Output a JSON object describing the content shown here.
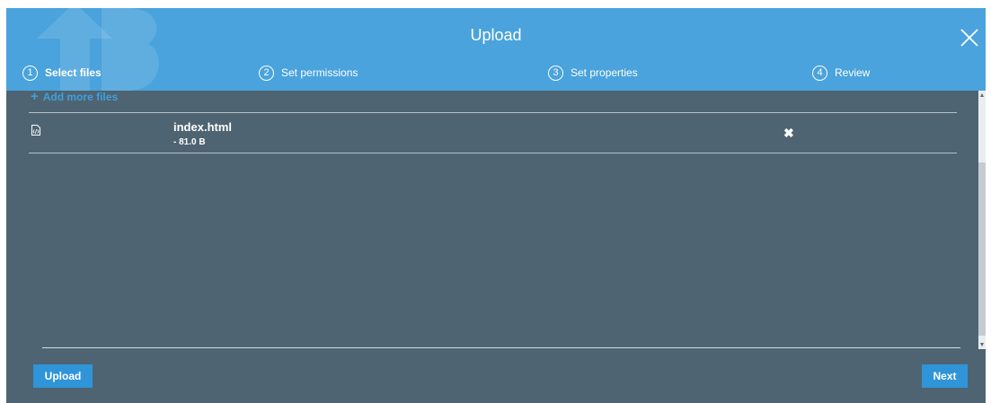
{
  "dialog": {
    "title": "Upload",
    "close_icon": "close-icon"
  },
  "steps": [
    {
      "number": "1",
      "label": "Select files",
      "active": true
    },
    {
      "number": "2",
      "label": "Set permissions",
      "active": false
    },
    {
      "number": "3",
      "label": "Set properties",
      "active": false
    },
    {
      "number": "4",
      "label": "Review",
      "active": false
    }
  ],
  "add_more": {
    "icon": "plus-icon",
    "label": "Add more files"
  },
  "files": [
    {
      "name": "index.html",
      "size": "- 81.0 B",
      "icon": "code-file-icon",
      "remove_icon": "remove-icon"
    }
  ],
  "footer": {
    "upload_label": "Upload",
    "next_label": "Next"
  },
  "colors": {
    "header": "#4aa3dc",
    "body": "#4e6472",
    "button": "#2f95d8",
    "link": "#3f9fdd"
  }
}
